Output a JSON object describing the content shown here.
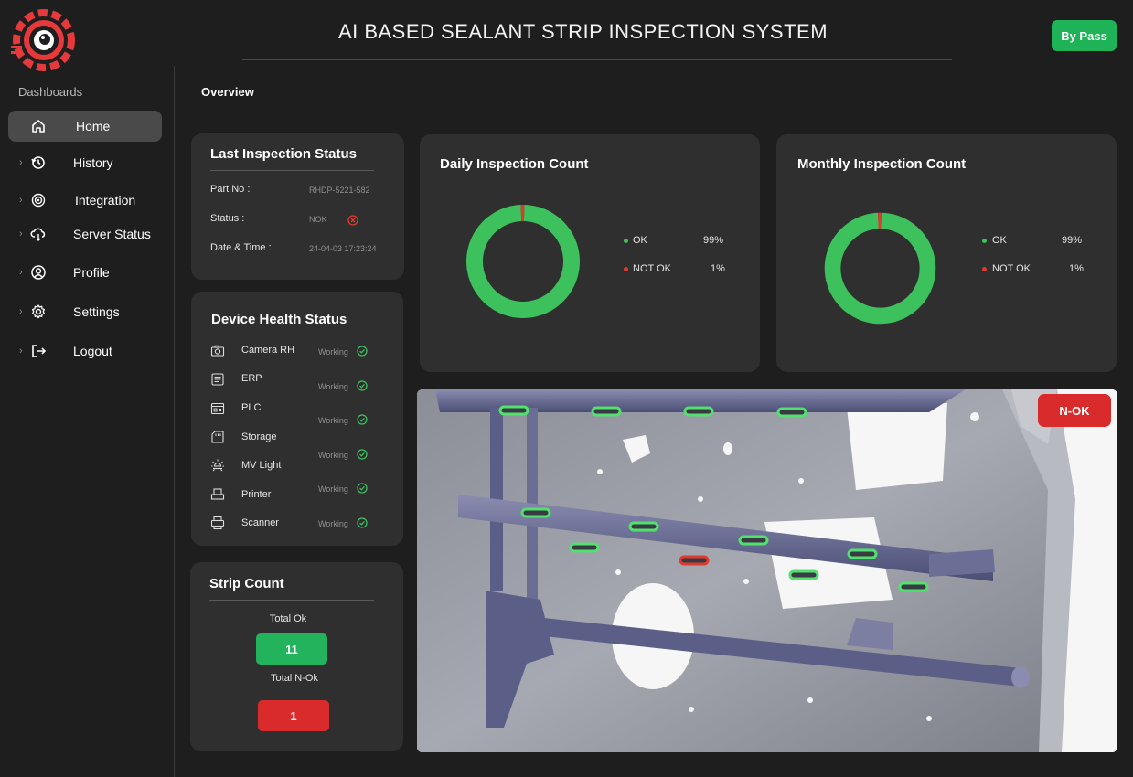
{
  "header": {
    "title": "AI BASED SEALANT STRIP  INSPECTION SYSTEM",
    "bypass_label": "By Pass"
  },
  "sidebar": {
    "section_label": "Dashboards",
    "items": [
      {
        "label": "Home",
        "icon": "home-icon",
        "active": true
      },
      {
        "label": "History",
        "icon": "history-icon"
      },
      {
        "label": "Integration",
        "icon": "integration-icon"
      },
      {
        "label": "Server Status",
        "icon": "cloud-server-icon"
      },
      {
        "label": "Profile",
        "icon": "profile-icon"
      },
      {
        "label": "Settings",
        "icon": "gear-icon"
      },
      {
        "label": "Logout",
        "icon": "logout-icon"
      }
    ]
  },
  "main": {
    "overview_label": "Overview",
    "last_inspection": {
      "title": "Last Inspection Status",
      "part_label": "Part No :",
      "part_value": "RHDP-5221-582",
      "status_label": "Status :",
      "status_value": "NOK",
      "datetime_label": "Date & Time :",
      "datetime_value": "24-04-03 17:23:24"
    },
    "device_health": {
      "title": "Device Health Status",
      "devices": [
        {
          "name": "Camera RH",
          "status": "Working",
          "icon": "camera-icon"
        },
        {
          "name": "ERP",
          "status": "Working",
          "icon": "erp-icon"
        },
        {
          "name": "PLC",
          "status": "Working",
          "icon": "plc-icon"
        },
        {
          "name": "Storage",
          "status": "Working",
          "icon": "storage-icon"
        },
        {
          "name": "MV Light",
          "status": "Working",
          "icon": "light-icon"
        },
        {
          "name": "Printer",
          "status": "Working",
          "icon": "printer-icon"
        },
        {
          "name": "Scanner",
          "status": "Working",
          "icon": "scanner-icon"
        }
      ]
    },
    "strip_count": {
      "title": "Strip Count",
      "ok_label": "Total Ok",
      "ok_value": "11",
      "nok_label": "Total N-Ok",
      "nok_value": "1"
    },
    "daily": {
      "title": "Daily Inspection Count",
      "legend": [
        {
          "label": "OK",
          "value": "99%"
        },
        {
          "label": "NOT OK",
          "value": "1%"
        }
      ]
    },
    "monthly": {
      "title": "Monthly Inspection Count",
      "legend": [
        {
          "label": "OK",
          "value": "99%"
        },
        {
          "label": "NOT OK",
          "value": "1%"
        }
      ]
    },
    "inspection_image": {
      "result_badge": "N-OK"
    }
  },
  "colors": {
    "ok": "#3cc15c",
    "nok": "#e03a2f",
    "bypass": "#1fb358",
    "nok_badge": "#d92b2b",
    "card": "#2f2f2f",
    "background": "#1e1e1e"
  },
  "chart_data": [
    {
      "type": "pie",
      "title": "Daily Inspection Count",
      "categories": [
        "OK",
        "NOT OK"
      ],
      "values": [
        99,
        1
      ]
    },
    {
      "type": "pie",
      "title": "Monthly Inspection Count",
      "categories": [
        "OK",
        "NOT OK"
      ],
      "values": [
        99,
        1
      ]
    }
  ]
}
